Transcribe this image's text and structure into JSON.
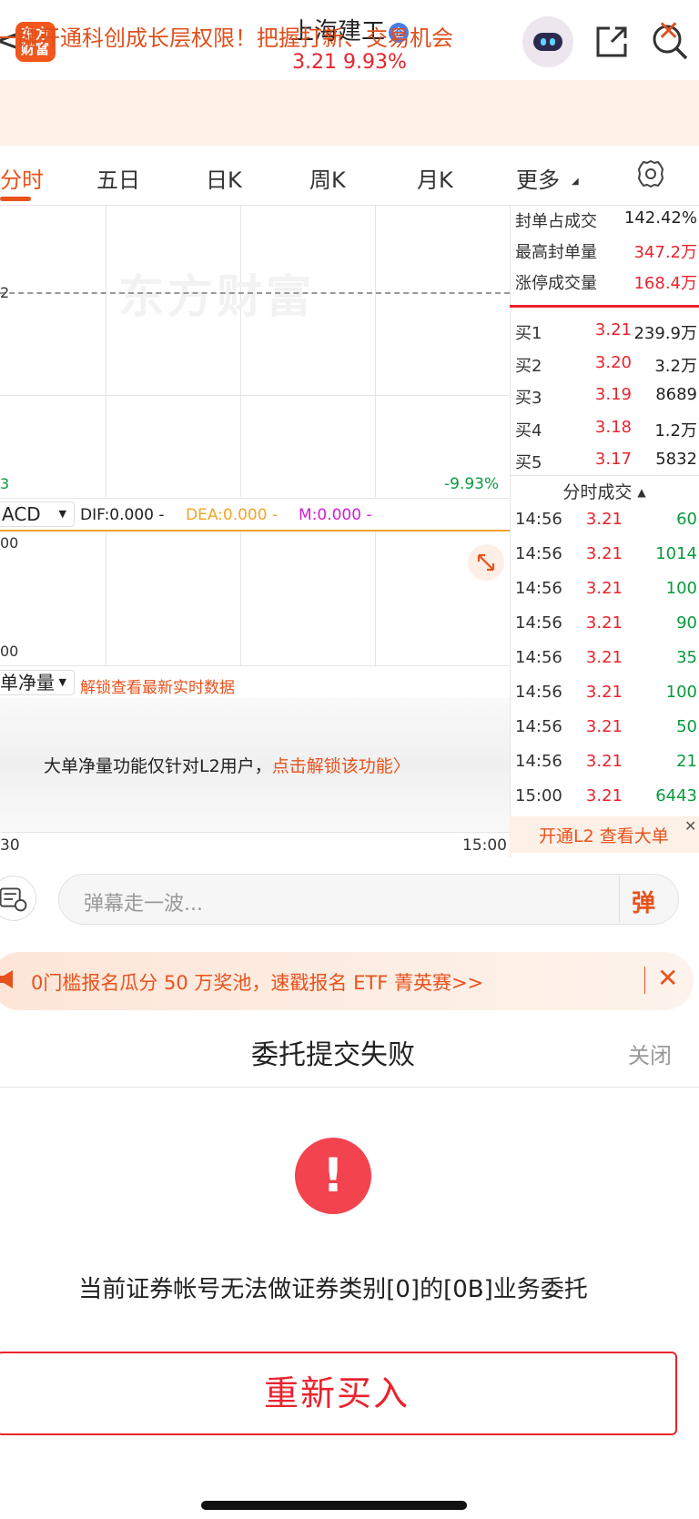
{
  "header": {
    "back": "<",
    "logo_text": "东方财富",
    "stock_name": "上海建工",
    "badge": "企",
    "price": "3.21",
    "change_pct": "9.93%"
  },
  "promo": {
    "text": "一键开通科创成长层权限！把握打新、交易机会",
    "close": "✕"
  },
  "tabs": [
    {
      "label": "分时"
    },
    {
      "label": "五日"
    },
    {
      "label": "日K"
    },
    {
      "label": "周K"
    },
    {
      "label": "月K"
    },
    {
      "label": "更多"
    }
  ],
  "chart": {
    "watermark": "东方财富",
    "left_label_top": "2",
    "left_label_bottom": "3",
    "right_label_bottom": "-9.93%",
    "macd": {
      "selector": "ACD",
      "dif": "DIF:0.000 -",
      "dea": "DEA:0.000 -",
      "m": "M:0.000 -",
      "axis_top": "00",
      "axis_bottom": "00"
    },
    "net": {
      "selector": "单净量",
      "unlock_link": "解锁查看最新实时数据",
      "msg": "大单净量功能仅针对L2用户，",
      "msg_link": "点击解锁该功能〉"
    },
    "time_start": "30",
    "time_end": "15:00"
  },
  "stats": [
    {
      "label": "封单占成交",
      "value": "142.42%",
      "color": "#222222"
    },
    {
      "label": "最高封单量",
      "value": "347.2万",
      "color": "#e8242e"
    },
    {
      "label": "涨停成交量",
      "value": "168.4万",
      "color": "#e8242e"
    }
  ],
  "bids": [
    {
      "label": "买1",
      "price": "3.21",
      "volume": "239.9万"
    },
    {
      "label": "买2",
      "price": "3.20",
      "volume": "3.2万"
    },
    {
      "label": "买3",
      "price": "3.19",
      "volume": "8689"
    },
    {
      "label": "买4",
      "price": "3.18",
      "volume": "1.2万"
    },
    {
      "label": "买5",
      "price": "3.17",
      "volume": "5832"
    }
  ],
  "ticks_title": "分时成交",
  "ticks": [
    {
      "time": "14:56",
      "price": "3.21",
      "vol": "60"
    },
    {
      "time": "14:56",
      "price": "3.21",
      "vol": "1014"
    },
    {
      "time": "14:56",
      "price": "3.21",
      "vol": "100"
    },
    {
      "time": "14:56",
      "price": "3.21",
      "vol": "90"
    },
    {
      "time": "14:56",
      "price": "3.21",
      "vol": "35"
    },
    {
      "time": "14:56",
      "price": "3.21",
      "vol": "100"
    },
    {
      "time": "14:56",
      "price": "3.21",
      "vol": "50"
    },
    {
      "time": "14:56",
      "price": "3.21",
      "vol": "21"
    },
    {
      "time": "15:00",
      "price": "3.21",
      "vol": "6443"
    }
  ],
  "l2_bar": "开通L2 查看大单",
  "danmu": {
    "placeholder": "弹幕走一波...",
    "button": "弹"
  },
  "etf_banner": {
    "text": "0门槛报名瓜分 50 万奖池，速戳报名 ETF 菁英赛>>",
    "close": "✕"
  },
  "dialog": {
    "title": "委托提交失败",
    "close": "关闭",
    "icon": "!",
    "message": "当前证券帐号无法做证券类别[0]的[0B]业务委托",
    "button": "重新买入"
  }
}
